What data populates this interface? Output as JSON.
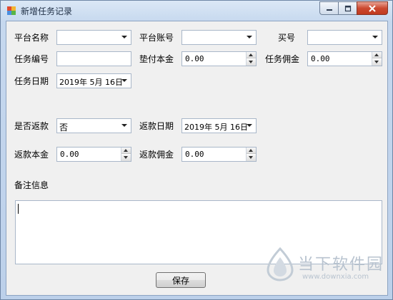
{
  "window": {
    "title": "新增任务记录"
  },
  "form": {
    "platform_name_label": "平台名称",
    "platform_name_value": "",
    "platform_account_label": "平台账号",
    "platform_account_value": "",
    "buyer_label": "买号",
    "buyer_value": "",
    "task_no_label": "任务编号",
    "task_no_value": "",
    "advance_principal_label": "垫付本金",
    "advance_principal_value": "0.00",
    "task_commission_label": "任务佣金",
    "task_commission_value": "0.00",
    "task_date_label": "任务日期",
    "task_date_value": "2019年  5月 16日",
    "refunded_label": "是否返款",
    "refunded_value": "否",
    "refund_date_label": "返款日期",
    "refund_date_value": "2019年  5月 16日",
    "refund_principal_label": "返款本金",
    "refund_principal_value": "0.00",
    "refund_commission_label": "返款佣金",
    "refund_commission_value": "0.00",
    "notes_label": "备注信息",
    "notes_value": "",
    "save_label": "保存"
  },
  "watermark": {
    "title": "当下软件园",
    "url": "www.downxia.com"
  },
  "colors": {
    "client_bg": "#f0f0f0",
    "frame": "#c6d8ee",
    "close_button": "#c8452b",
    "watermark": "#b8c3cf"
  }
}
